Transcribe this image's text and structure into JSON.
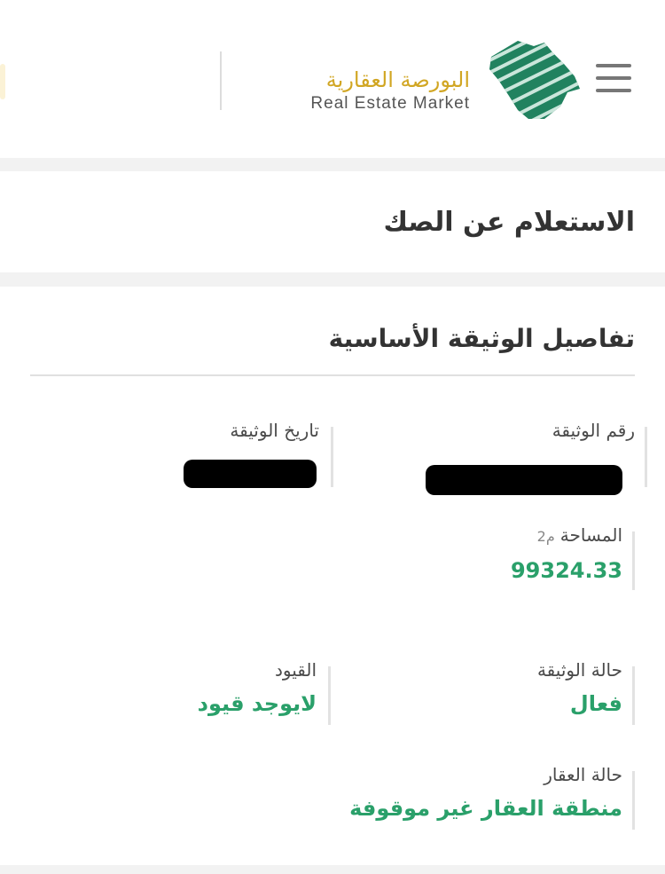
{
  "header": {
    "brand_arabic": "البورصة العقارية",
    "brand_english": "Real Estate Market",
    "icons": [
      "menu-icon",
      "saudi-map-logo"
    ]
  },
  "page": {
    "title": "الاستعلام عن الصك"
  },
  "document": {
    "section_title": "تفاصيل الوثيقة الأساسية",
    "fields": {
      "document_number_label": "رقم الوثيقة",
      "document_date_label": "تاريخ الوثيقة",
      "area_label": "المساحة",
      "area_unit": "م2",
      "area_value": "99324.33",
      "document_status_label": "حالة الوثيقة",
      "document_status_value": "فعال",
      "restrictions_label": "القيود",
      "restrictions_value": "لايوجد قيود",
      "property_status_label": "حالة العقار",
      "property_status_value": "منطقة العقار غير موقوفة"
    }
  },
  "colors": {
    "brand_gold": "#d1a623",
    "status_green": "#2aa06a",
    "logo_green": "#1e7a5a"
  }
}
